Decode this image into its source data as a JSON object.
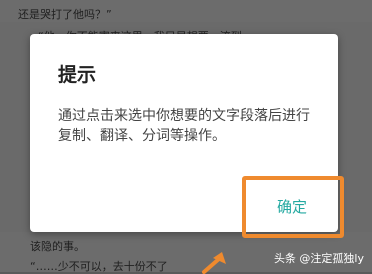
{
  "background": {
    "line1": "还是哭打了他吗？”",
    "line2": "“他，你不能害来这里，我只是想要一流到",
    "line3": "该隐的事。",
    "line4": "“……少不可以，去十份不了"
  },
  "dialog": {
    "title": "提示",
    "message": "通过点击来选中你想要的文字段落后进行复制、翻译、分词等操作。",
    "ok_label": "确定"
  },
  "watermark": "头条 @注定孤独ly",
  "colors": {
    "accent": "#24a9a1",
    "highlight": "#ef8a2e"
  }
}
